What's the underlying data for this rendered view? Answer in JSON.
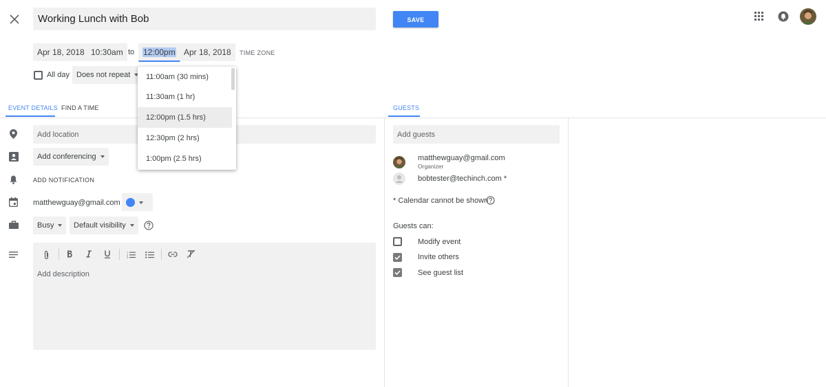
{
  "header": {
    "title": "Working Lunch with Bob",
    "save_label": "SAVE"
  },
  "datetime": {
    "start_date": "Apr 18, 2018",
    "start_time": "10:30am",
    "to_label": "to",
    "end_time": "12:00pm",
    "end_date": "Apr 18, 2018",
    "time_zone_label": "TIME ZONE",
    "all_day_label": "All day",
    "repeat_label": "Does not repeat"
  },
  "time_dropdown": {
    "options": [
      "11:00am (30 mins)",
      "11:30am (1 hr)",
      "12:00pm (1.5 hrs)",
      "12:30pm (2 hrs)",
      "1:00pm (2.5 hrs)"
    ],
    "highlighted_index": 2
  },
  "tabs": {
    "event_details": "EVENT DETAILS",
    "find_a_time": "FIND A TIME",
    "guests": "GUESTS"
  },
  "details": {
    "location_placeholder": "Add location",
    "conferencing_label": "Add conferencing",
    "notification_label": "ADD NOTIFICATION",
    "calendar_owner": "matthewguay@gmail.com",
    "calendar_color": "#4285f4",
    "availability_label": "Busy",
    "visibility_label": "Default visibility",
    "description_placeholder": "Add description"
  },
  "guests": {
    "add_placeholder": "Add guests",
    "list": [
      {
        "email": "matthewguay@gmail.com",
        "role": "Organizer"
      },
      {
        "email": "bobtester@techinch.com *",
        "role": ""
      }
    ],
    "calendar_note": "* Calendar cannot be shown",
    "guests_can_label": "Guests can:",
    "permissions": [
      {
        "label": "Modify event",
        "checked": false
      },
      {
        "label": "Invite others",
        "checked": true
      },
      {
        "label": "See guest list",
        "checked": true
      }
    ]
  },
  "colors": {
    "accent": "#4285f4",
    "field_bg": "#f1f1f1"
  },
  "icons": [
    "close-icon",
    "apps-grid-icon",
    "notifications-icon",
    "avatar",
    "location-pin-icon",
    "conferencing-icon",
    "bell-icon",
    "calendar-icon",
    "briefcase-icon",
    "description-lines-icon",
    "help-icon",
    "attach-icon",
    "bold-icon",
    "italic-icon",
    "underline-icon",
    "numbered-list-icon",
    "bulleted-list-icon",
    "link-icon",
    "clear-format-icon"
  ]
}
